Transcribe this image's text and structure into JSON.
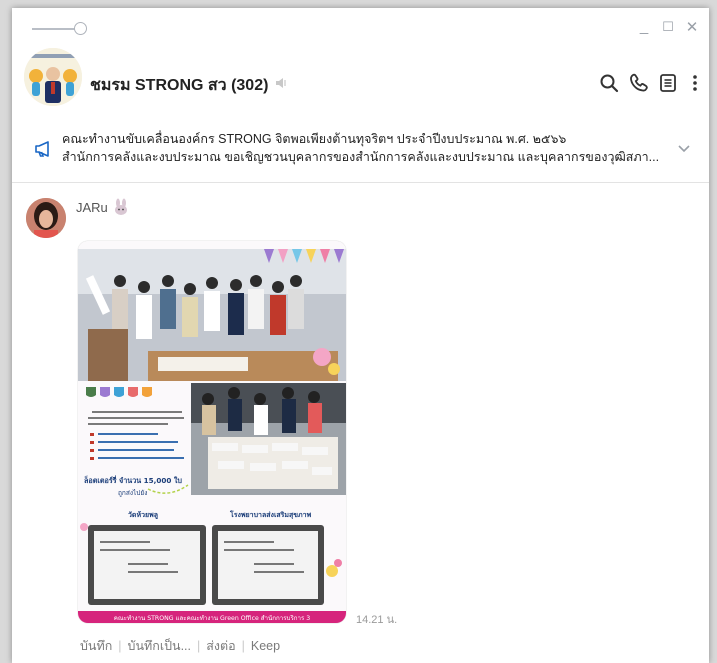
{
  "window": {
    "minimize": "_",
    "maximize": "☐",
    "close": "✕"
  },
  "header": {
    "chat_name": "ชมรม STRONG สว (302)",
    "icons": [
      "search-icon",
      "phone-icon",
      "notes-icon",
      "more-icon"
    ]
  },
  "announcement": {
    "line1": "คณะทำงานขับเคลื่อนองค์กร STRONG จิตพอเพียงต้านทุจริตฯ ประจำปีงบประมาณ พ.ศ. ๒๕๖๖",
    "line2": "สำนักการคลังและงบประมาณ ขอเชิญชวนบุคลากรของสำนักการคลังและงบประมาณ และบุคลากรของวุฒิสภา..."
  },
  "message": {
    "sender": "JARu",
    "time": "14.21 น.",
    "image": {
      "poster_text": "ล็อตเตอร์รี่ จำนวน 15,000 ใบ",
      "poster_sub": "ถูกส่งไปยัง",
      "dest_1": "วัดห้วยพลู",
      "dest_2": "โรงพยาบาลส่งเสริมสุขภาพ",
      "footer": "คณะทำงาน STRONG และคณะทำงาน Green Office สำนักการบริการ 3"
    },
    "actions": [
      "บันทึก",
      "บันทึกเป็น...",
      "ส่งต่อ",
      "Keep"
    ]
  },
  "colors": {
    "accent_pink": "#d6247c",
    "icon_blue": "#1a67c5",
    "muted_text": "#9a9a9a"
  }
}
